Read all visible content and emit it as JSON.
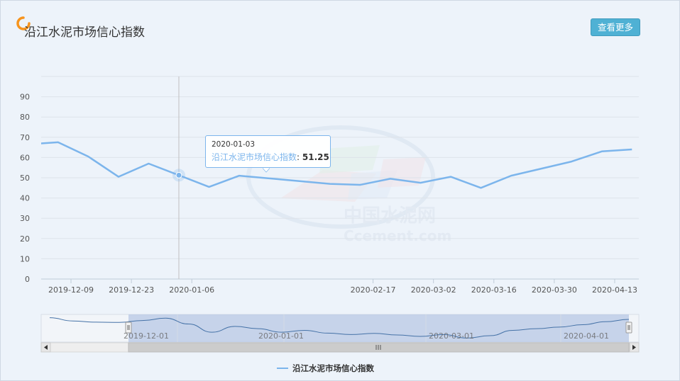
{
  "header": {
    "title": "沿江水泥市场信心指数",
    "more_label": "查看更多",
    "icon": "ring-icon"
  },
  "watermark": {
    "cn": "中国水泥网",
    "en": "Ccement.com"
  },
  "tooltip": {
    "date": "2020-01-03",
    "series": "沿江水泥市场信心指数",
    "value": "51.25"
  },
  "legend": {
    "label": "沿江水泥市场信心指数"
  },
  "navigator": {
    "labels": [
      "2019-12-01",
      "2020-01-01",
      "2020-03-01",
      "2020-04-01"
    ],
    "scroll_left_icon": "arrow-left-icon",
    "scroll_right_icon": "arrow-right-icon",
    "scroll_grip_icon": "grip-icon"
  },
  "colors": {
    "series": "#7cb5ec",
    "navigator_series": "#4572a7",
    "button": "#4fb1d4"
  },
  "chart_data": {
    "type": "line",
    "title": "",
    "xlabel": "",
    "ylabel": "",
    "ylim": [
      0,
      90
    ],
    "yticks": [
      0,
      10,
      20,
      30,
      40,
      50,
      60,
      70,
      80,
      90
    ],
    "grid": true,
    "legend_position": "bottom-center",
    "xticks": [
      "2019-12-09",
      "2019-12-23",
      "2020-01-06",
      "2020-02-17",
      "2020-03-02",
      "2020-03-16",
      "2020-03-30",
      "2020-04-13"
    ],
    "series": [
      {
        "name": "沿江水泥市场信心指数",
        "x": [
          "2019-11-29",
          "2019-12-06",
          "2019-12-13",
          "2019-12-20",
          "2019-12-27",
          "2020-01-03",
          "2020-01-10",
          "2020-01-17",
          "2020-02-07",
          "2020-02-14",
          "2020-02-21",
          "2020-02-28",
          "2020-03-06",
          "2020-03-13",
          "2020-03-20",
          "2020-03-27",
          "2020-04-03",
          "2020-04-10",
          "2020-04-17"
        ],
        "values": [
          66.5,
          67.5,
          60.5,
          50.5,
          57,
          51.25,
          45.5,
          51,
          47,
          46.5,
          49.5,
          47.5,
          50.5,
          45,
          51,
          54.5,
          58,
          63,
          64
        ]
      }
    ],
    "highlighted_point": {
      "x": "2020-01-03",
      "y": 51.25
    }
  }
}
